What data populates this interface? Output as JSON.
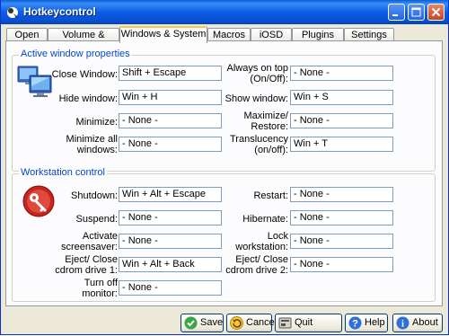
{
  "window": {
    "title": "Hotkeycontrol"
  },
  "colors": {
    "titlebar": "#0b5ee6",
    "group_title": "#0046d5",
    "active_tab_accent": "#ffc83c"
  },
  "tabs": [
    {
      "label": "Open"
    },
    {
      "label": "Volume & Media"
    },
    {
      "label": "Windows & System"
    },
    {
      "label": "Macros"
    },
    {
      "label": "iOSD"
    },
    {
      "label": "Plugins"
    },
    {
      "label": "Settings"
    }
  ],
  "active_tab": "Windows & System",
  "active_window": {
    "title": "Active window properties",
    "icon": "monitors-icon",
    "rows": [
      {
        "left_label": "Close Window:",
        "left_value": "Shift + Escape",
        "right_label": "Always on top (On/Off):",
        "right_value": "- None -"
      },
      {
        "left_label": "Hide window:",
        "left_value": "Win + H",
        "right_label": "Show window:",
        "right_value": "Win + S"
      },
      {
        "left_label": "Minimize:",
        "left_value": "- None -",
        "right_label": "Maximize/ Restore:",
        "right_value": "- None -"
      },
      {
        "left_label": "Minimize all windows:",
        "left_value": "- None -",
        "right_label": "Translucency (on/off):",
        "right_value": "Win + T"
      }
    ]
  },
  "workstation": {
    "title": "Workstation control",
    "icon": "workstation-key-icon",
    "rows": [
      {
        "left_label": "Shutdown:",
        "left_value": "Win + Alt + Escape",
        "right_label": "Restart:",
        "right_value": "- None -"
      },
      {
        "left_label": "Suspend:",
        "left_value": "- None -",
        "right_label": "Hibernate:",
        "right_value": "- None -"
      },
      {
        "left_label": "Activate screensaver:",
        "left_value": "- None -",
        "right_label": "Lock workstation:",
        "right_value": "- None -"
      },
      {
        "left_label": "Eject/ Close cdrom drive 1:",
        "left_value": "Win + Alt + Back",
        "right_label": "Eject/ Close cdrom drive 2:",
        "right_value": "- None -"
      },
      {
        "left_label": "Turn off monitor:",
        "left_value": "- None -"
      }
    ]
  },
  "buttons": {
    "save": {
      "label": "Save",
      "icon": "check-icon"
    },
    "cancel": {
      "label": "Cancel",
      "icon": "undo-icon"
    },
    "quit": {
      "label": "Quit program",
      "icon": "quit-icon"
    },
    "help": {
      "label": "Help",
      "icon": "help-icon"
    },
    "about": {
      "label": "About",
      "icon": "about-icon"
    }
  }
}
